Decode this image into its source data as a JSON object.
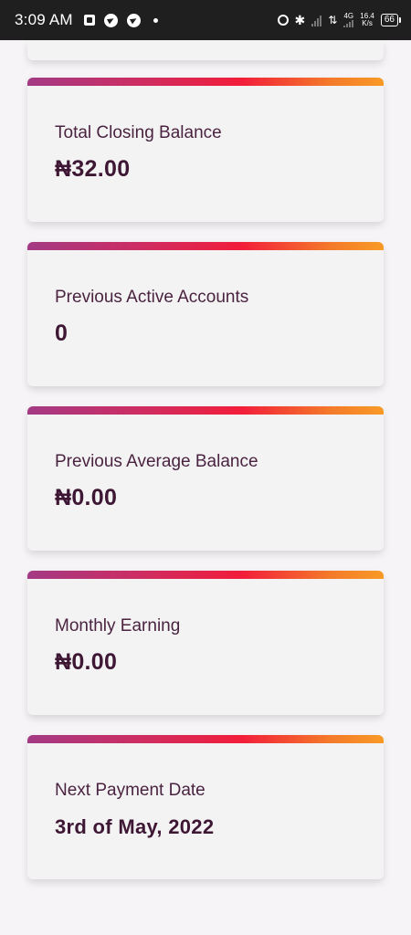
{
  "status_bar": {
    "time": "3:09 AM",
    "network": "4G",
    "speed_value": "16.4",
    "speed_unit": "K/s",
    "battery": "66"
  },
  "cards": [
    {
      "label": "Total Closing Balance",
      "value": "₦32.00"
    },
    {
      "label": "Previous Active Accounts",
      "value": "0"
    },
    {
      "label": "Previous Average Balance",
      "value": "₦0.00"
    },
    {
      "label": "Monthly Earning",
      "value": "₦0.00"
    },
    {
      "label": "Next Payment Date",
      "value": "3rd of May, 2022"
    }
  ]
}
